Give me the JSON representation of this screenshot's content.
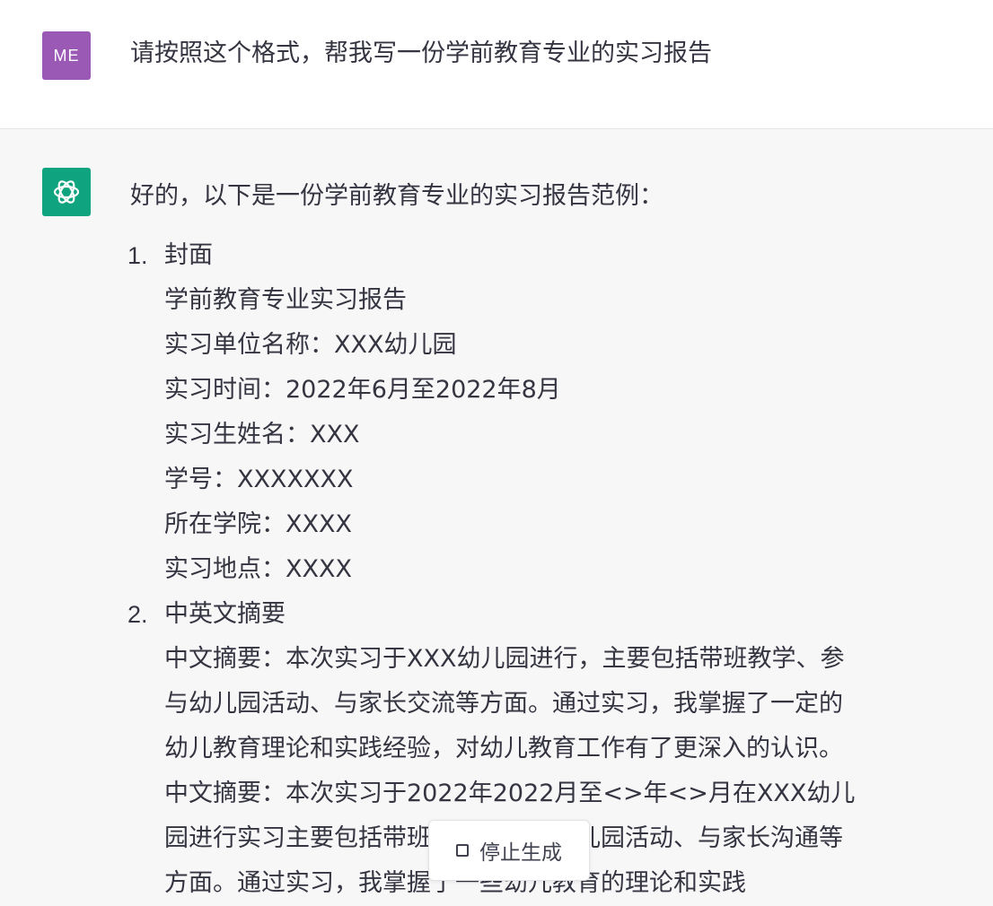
{
  "colors": {
    "user_avatar_bg": "#9b59b6",
    "assistant_avatar_bg": "#10a37f",
    "text": "#343541"
  },
  "user": {
    "avatar_initials": "ME",
    "message": "请按照这个格式，帮我写一份学前教育专业的实习报告"
  },
  "assistant": {
    "avatar_icon": "openai-logo-icon",
    "intro": "好的，以下是一份学前教育专业的实习报告范例：",
    "sections": [
      {
        "number": "1.",
        "title": "封面",
        "lines": [
          "学前教育专业实习报告",
          "实习单位名称：XXX幼儿园",
          "实习时间：2022年6月至2022年8月",
          "实习生姓名：XXX",
          "学号：XXXXXXX",
          "所在学院：XXXX",
          "实习地点：XXXX"
        ]
      },
      {
        "number": "2.",
        "title": "中英文摘要",
        "paragraph": "中文摘要：本次实习于XXX幼儿园进行，主要包括带班教学、参与幼儿园活动、与家长交流等方面。通过实习，我掌握了一定的幼儿教育理论和实践经验，对幼儿教育工作有了更深入的认识。中文摘要：本次实习于2022年2022月至<>年<>月在XXX幼儿园进行实习主要包括带班教学、参加幼儿园活动、与家长沟通等方面。通过实习，我掌握了一些幼儿教育的理论和实践"
      }
    ]
  },
  "stop_button": {
    "icon": "stop-square-icon",
    "label": "停止生成"
  }
}
